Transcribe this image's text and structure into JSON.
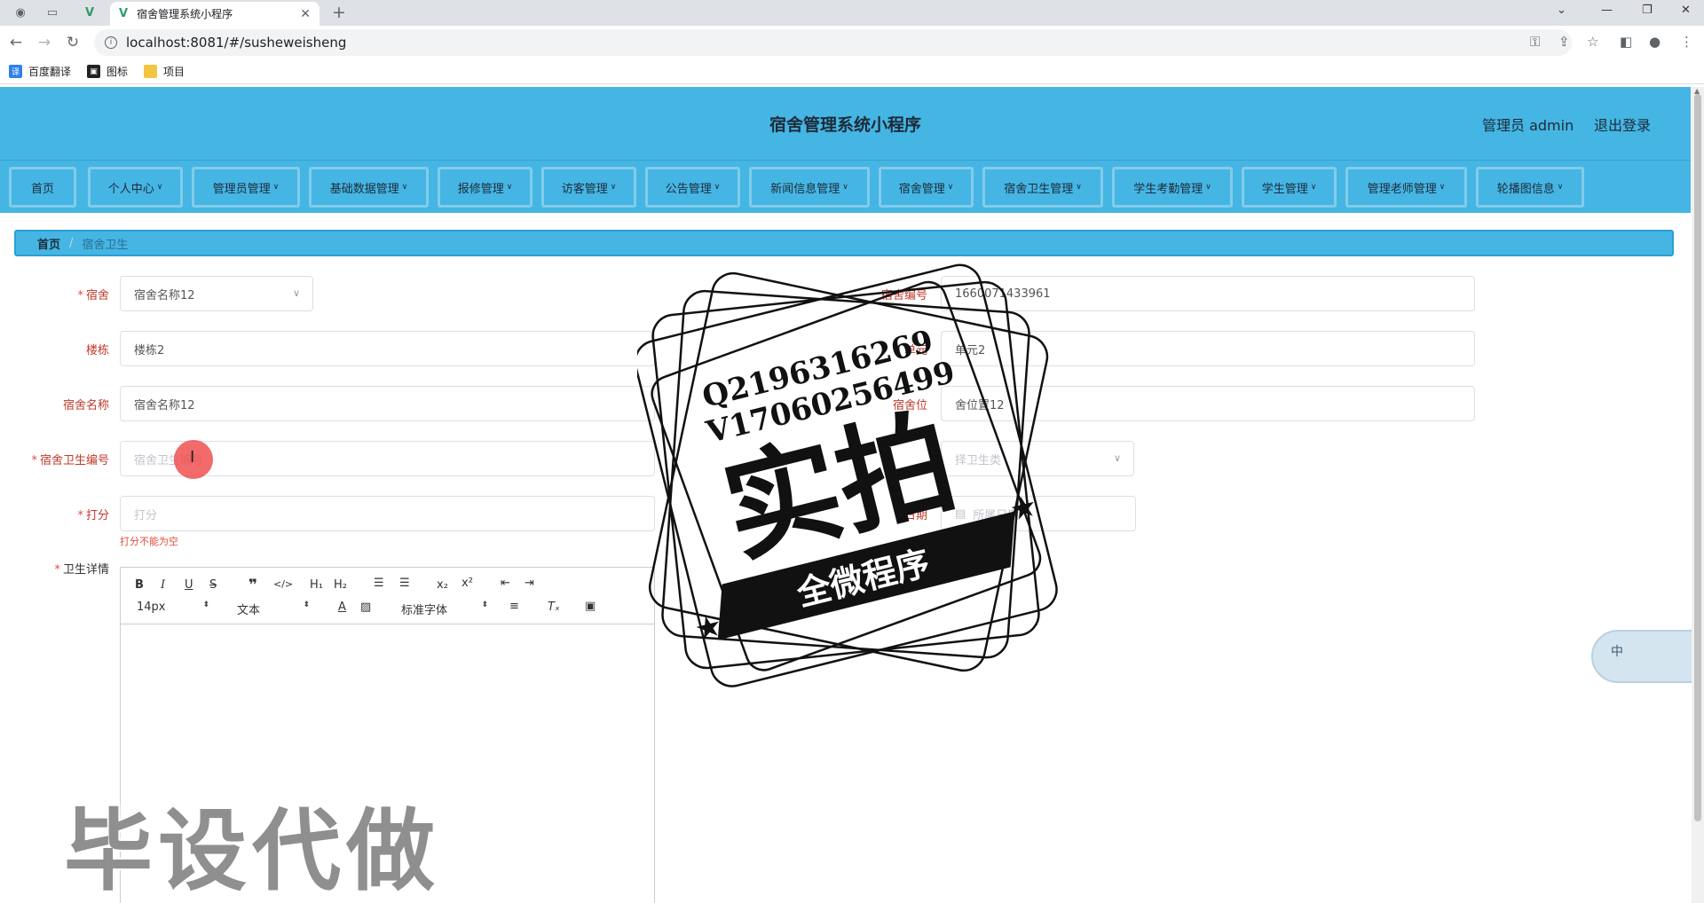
{
  "browser": {
    "tab_title": "宿舍管理系统小程序",
    "url": "localhost:8081/#/susheweisheng",
    "bookmarks": [
      "百度翻译",
      "图标",
      "项目"
    ],
    "bookmark_icon_text": "译"
  },
  "header": {
    "title": "宿舍管理系统小程序",
    "user": "管理员 admin",
    "logout": "退出登录"
  },
  "nav": {
    "home": "首页",
    "items": [
      "个人中心",
      "管理员管理",
      "基础数据管理",
      "报修管理",
      "访客管理",
      "公告管理",
      "新闻信息管理",
      "宿舍管理",
      "宿舍卫生管理",
      "学生考勤管理",
      "学生管理",
      "管理老师管理",
      "轮播图信息"
    ]
  },
  "breadcrumb": {
    "home": "首页",
    "separator": "/",
    "current": "宿舍卫生"
  },
  "form": {
    "dorm_label": "宿舍",
    "dorm_value": "宿舍名称12",
    "dorm_no_label": "宿舍编号",
    "dorm_no_value": "1660071433961",
    "building_label": "楼栋",
    "building_value": "楼栋2",
    "unit_label": "单元",
    "unit_value": "单元2",
    "dorm_name_label": "宿舍名称",
    "dorm_name_value": "宿舍名称12",
    "dorm_pos_label": "宿舍位",
    "dorm_pos_value": "舍位置12",
    "hygiene_no_label": "宿舍卫生编号",
    "hygiene_no_placeholder": "宿舍卫生编号",
    "hygiene_type_placeholder": "择卫生类",
    "score_label": "打分",
    "score_placeholder": "打分",
    "score_error": "打分不能为空",
    "date_label": "日期",
    "date_placeholder": "所属日期",
    "detail_label": "卫生详情"
  },
  "editor": {
    "font_size": "14px",
    "block_type": "文本",
    "font_family": "标准字体"
  },
  "watermark": {
    "stamp_line1": "Q2196316269",
    "stamp_line2": "V17060256499",
    "stamp_main": "实拍",
    "stamp_banner": "全微程序",
    "bottom": "毕设代做"
  },
  "ime": {
    "mode": "中"
  }
}
